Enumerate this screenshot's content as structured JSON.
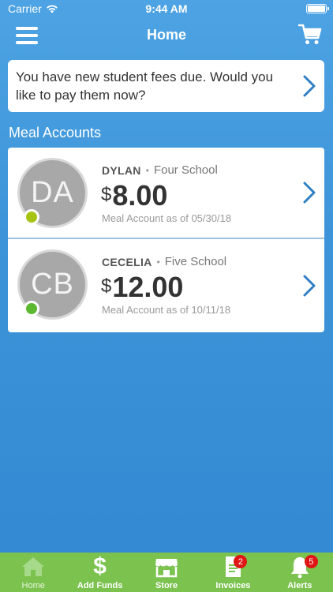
{
  "status_bar": {
    "carrier": "Carrier",
    "time": "9:44 AM"
  },
  "nav": {
    "title": "Home",
    "menu_icon": "hamburger-menu-icon",
    "cart_icon": "shopping-cart-icon"
  },
  "fees_banner": {
    "text": "You have new student fees due. Would you like to pay them now?"
  },
  "meal_accounts": {
    "title": "Meal Accounts",
    "accounts": [
      {
        "initials": "DA",
        "name": "DYLAN",
        "separator": "•",
        "school": "Four School",
        "currency": "$",
        "balance": "8.00",
        "as_of": "Meal Account as of 05/30/18",
        "status_color": "#a7c413"
      },
      {
        "initials": "CB",
        "name": "CECELIA",
        "separator": "•",
        "school": "Five School",
        "currency": "$",
        "balance": "12.00",
        "as_of": "Meal Account as of 10/11/18",
        "status_color": "#5cb82e"
      }
    ]
  },
  "tab_bar": {
    "tabs": [
      {
        "label": "Home",
        "icon": "home-icon",
        "active": true
      },
      {
        "label": "Add Funds",
        "icon": "dollar-icon"
      },
      {
        "label": "Store",
        "icon": "store-icon"
      },
      {
        "label": "Invoices",
        "icon": "invoice-icon",
        "badge": "2"
      },
      {
        "label": "Alerts",
        "icon": "bell-icon",
        "badge": "5"
      }
    ]
  },
  "colors": {
    "background": "#3d94d8",
    "tab_bar": "#7bc24f",
    "badge": "#e01515",
    "chevron": "#2f7fc4"
  }
}
